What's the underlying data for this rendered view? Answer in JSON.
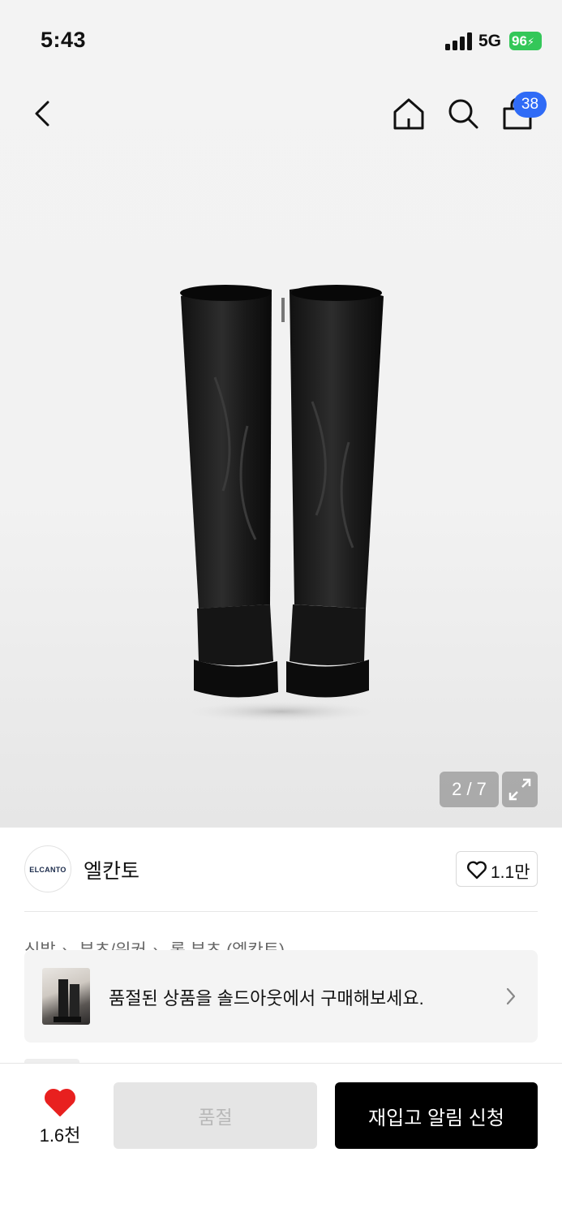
{
  "status_bar": {
    "time": "5:43",
    "network": "5G",
    "battery": "96"
  },
  "nav": {
    "cart_count": "38"
  },
  "product": {
    "image_counter": "2 / 7"
  },
  "brand": {
    "logo_text": "ELCANTO",
    "name": "엘칸토",
    "like_count": "1.1만"
  },
  "breadcrumb": [
    "신발",
    "부츠/워커",
    "롱 부츠 (엘칸토)"
  ],
  "soldout_banner": {
    "text": "품절된 상품을 솔드아웃에서 구매해보세요."
  },
  "bottom_bar": {
    "wish_count": "1.6천",
    "soldout_label": "품절",
    "restock_label": "재입고 알림 신청"
  },
  "colors": {
    "accent_blue": "#2f6bf6",
    "wish_red": "#e8201f",
    "battery_green": "#34c759"
  },
  "icons": [
    "back-icon",
    "home-icon",
    "search-icon",
    "cart-icon",
    "expand-icon",
    "heart-outline-icon",
    "chevron-right-icon",
    "heart-filled-icon"
  ]
}
